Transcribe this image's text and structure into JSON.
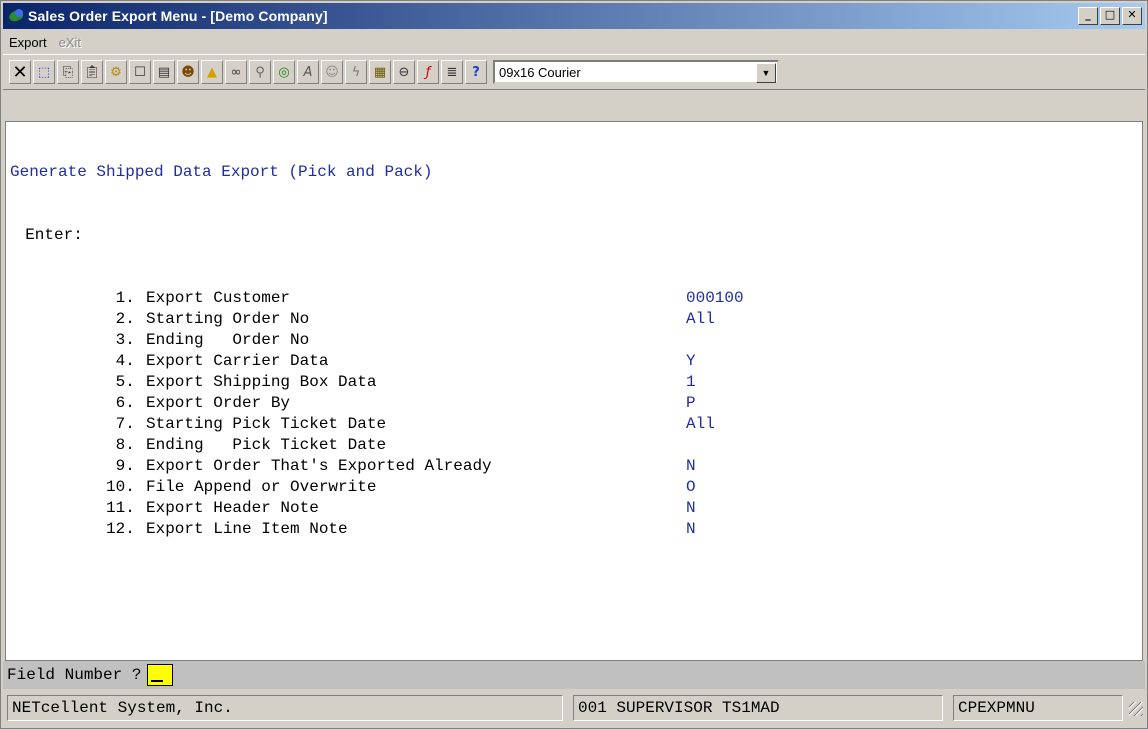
{
  "window": {
    "title": "Sales Order Export Menu - [Demo Company]"
  },
  "menu": [
    {
      "label": "Export",
      "enabled": true
    },
    {
      "label": "eXit",
      "enabled": false
    }
  ],
  "toolbar": {
    "icons": [
      "close-icon",
      "select-icon",
      "copy-icon",
      "paste-icon",
      "settings-icon",
      "properties-icon",
      "list-icon",
      "user-icon",
      "alert-icon",
      "binoculars-icon",
      "zoom-icon",
      "globe-icon",
      "font-icon",
      "help-person-icon",
      "lightning-icon",
      "calculator-icon",
      "link-icon",
      "function-icon",
      "notes-icon",
      "whats-this-icon"
    ],
    "font_select": {
      "value": "09x16 Courier"
    }
  },
  "screen": {
    "heading": "Generate Shipped Data Export (Pick and Pack)",
    "enter_label": "  Enter:",
    "fields": [
      {
        "num": " 1.",
        "label": "Export Customer",
        "value": "000100"
      },
      {
        "num": " 2.",
        "label": "Starting Order No",
        "value": "All"
      },
      {
        "num": " 3.",
        "label": "Ending   Order No",
        "value": ""
      },
      {
        "num": " 4.",
        "label": "Export Carrier Data",
        "value": "Y"
      },
      {
        "num": " 5.",
        "label": "Export Shipping Box Data",
        "value": "1"
      },
      {
        "num": " 6.",
        "label": "Export Order By",
        "value": "P"
      },
      {
        "num": " 7.",
        "label": "Starting Pick Ticket Date",
        "value": "All"
      },
      {
        "num": " 8.",
        "label": "Ending   Pick Ticket Date",
        "value": ""
      },
      {
        "num": " 9.",
        "label": "Export Order That's Exported Already",
        "value": "N"
      },
      {
        "num": "10.",
        "label": "File Append or Overwrite",
        "value": "O"
      },
      {
        "num": "11.",
        "label": "Export Header Note",
        "value": "N"
      },
      {
        "num": "12.",
        "label": "Export Line Item Note",
        "value": "N"
      }
    ]
  },
  "prompt": {
    "label": "Field Number ?"
  },
  "status": {
    "company": "NETcellent System, Inc.",
    "user": "001 SUPERVISOR TS1MAD",
    "program": "CPEXPMNU"
  }
}
